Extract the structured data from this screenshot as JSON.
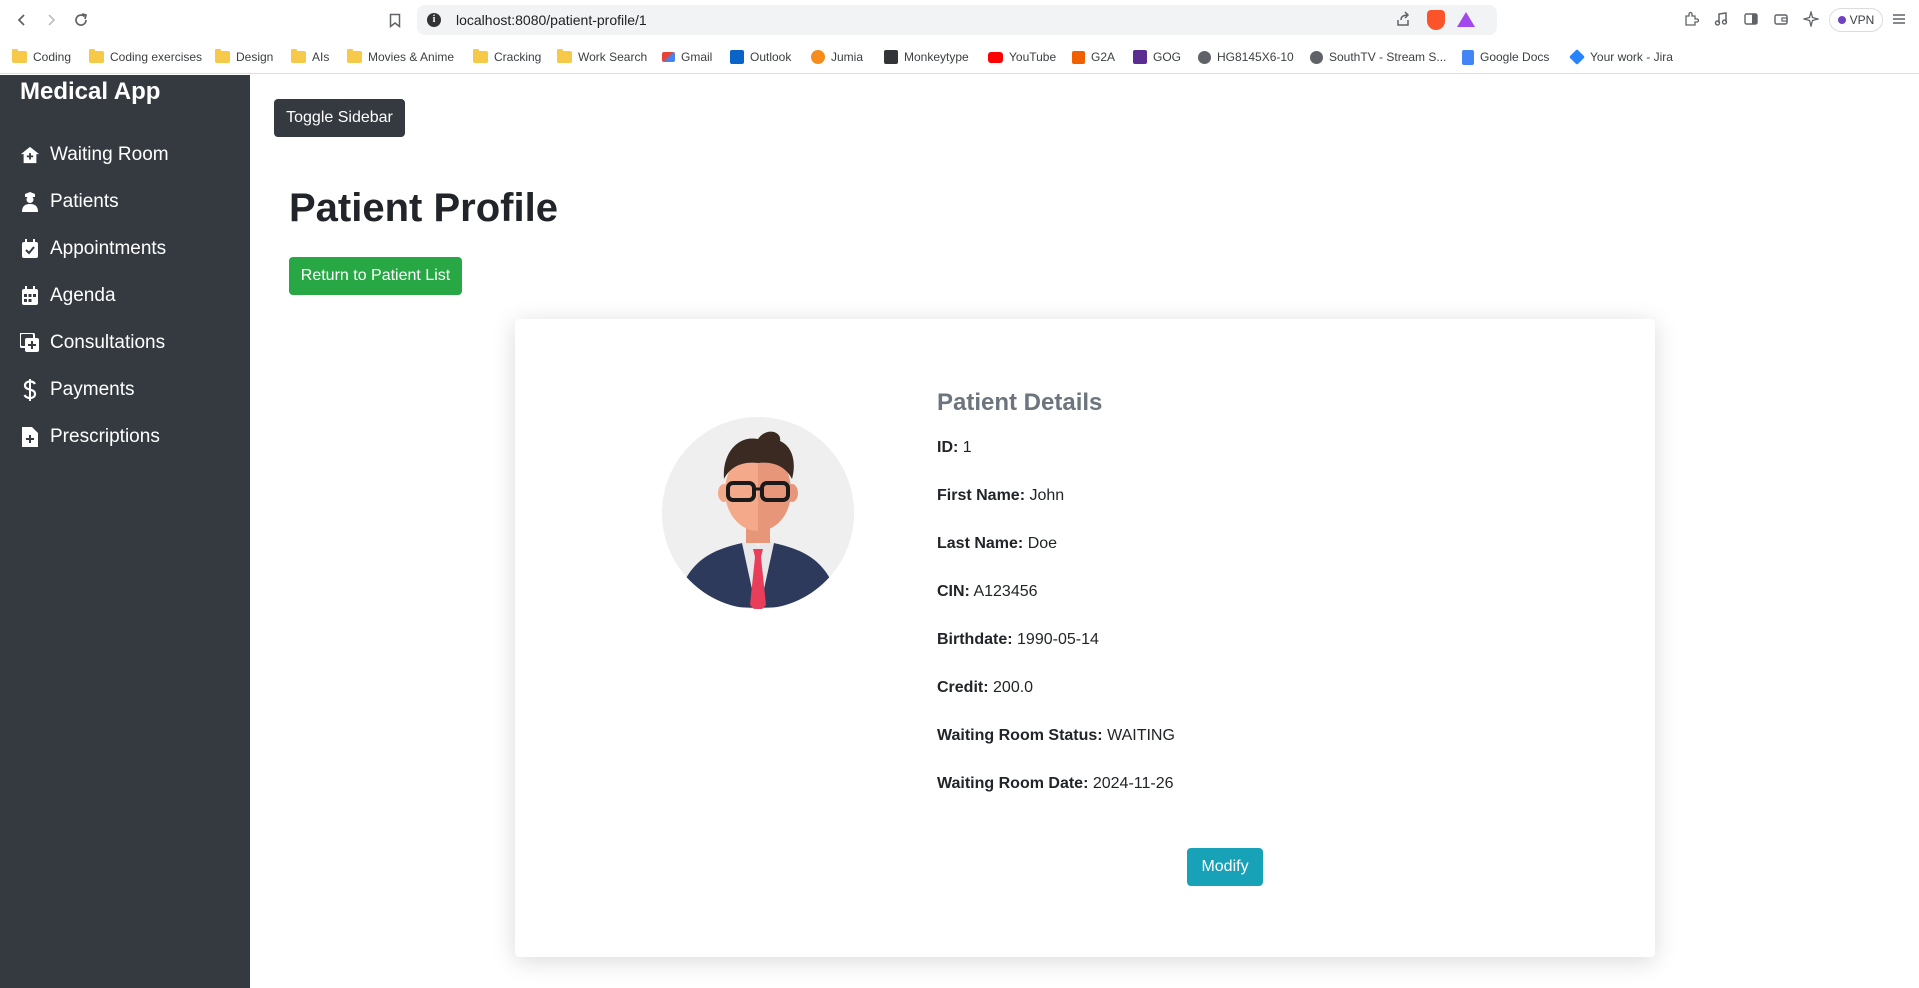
{
  "browser": {
    "url": "localhost:8080/patient-profile/1",
    "vpn_label": "VPN",
    "bookmarks": [
      {
        "label": "Coding",
        "icon": "folder-icon"
      },
      {
        "label": "Coding exercises",
        "icon": "folder-icon"
      },
      {
        "label": "Design",
        "icon": "folder-icon"
      },
      {
        "label": "AIs",
        "icon": "folder-icon"
      },
      {
        "label": "Movies & Anime",
        "icon": "folder-icon"
      },
      {
        "label": "Cracking",
        "icon": "folder-icon"
      },
      {
        "label": "Work Search",
        "icon": "folder-icon"
      },
      {
        "label": "Gmail",
        "icon": "gmail-icon"
      },
      {
        "label": "Outlook",
        "icon": "outlook-icon"
      },
      {
        "label": "Jumia",
        "icon": "jumia-icon"
      },
      {
        "label": "Monkeytype",
        "icon": "monkeytype-icon"
      },
      {
        "label": "YouTube",
        "icon": "youtube-icon"
      },
      {
        "label": "G2A",
        "icon": "g2a-icon"
      },
      {
        "label": "GOG",
        "icon": "gog-icon"
      },
      {
        "label": "HG8145X6-10",
        "icon": "globe-icon"
      },
      {
        "label": "SouthTV - Stream S...",
        "icon": "globe-icon"
      },
      {
        "label": "Google Docs",
        "icon": "google-docs-icon"
      },
      {
        "label": "Your work - Jira",
        "icon": "jira-icon"
      }
    ]
  },
  "sidebar": {
    "brand": "Medical App",
    "items": [
      {
        "label": "Waiting Room",
        "icon": "house-medical-icon"
      },
      {
        "label": "Patients",
        "icon": "user-nurse-icon"
      },
      {
        "label": "Appointments",
        "icon": "calendar-check-icon"
      },
      {
        "label": "Agenda",
        "icon": "calendar-icon"
      },
      {
        "label": "Consultations",
        "icon": "notes-medical-icon"
      },
      {
        "label": "Payments",
        "icon": "dollar-icon"
      },
      {
        "label": "Prescriptions",
        "icon": "file-medical-icon"
      }
    ]
  },
  "main": {
    "toggle_label": "Toggle Sidebar",
    "title": "Patient Profile",
    "return_label": "Return to Patient List",
    "details_title": "Patient Details",
    "fields": [
      {
        "label": "ID:",
        "value": "1"
      },
      {
        "label": "First Name:",
        "value": "John"
      },
      {
        "label": "Last Name:",
        "value": "Doe"
      },
      {
        "label": "CIN:",
        "value": "A123456"
      },
      {
        "label": "Birthdate:",
        "value": "1990-05-14"
      },
      {
        "label": "Credit:",
        "value": "200.0"
      },
      {
        "label": "Waiting Room Status:",
        "value": "WAITING"
      },
      {
        "label": "Waiting Room Date:",
        "value": "2024-11-26"
      }
    ],
    "modify_label": "Modify"
  },
  "colors": {
    "sidebar_bg": "#343a40",
    "success": "#28a745",
    "info": "#17a2b8"
  }
}
